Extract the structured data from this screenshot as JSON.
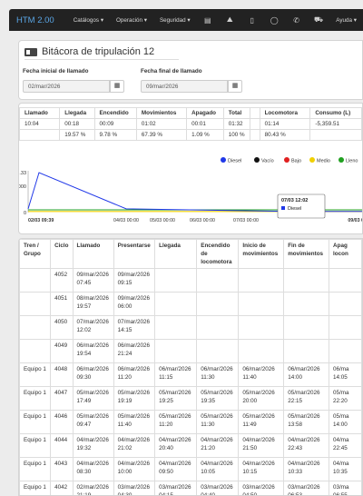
{
  "nav": {
    "brand": "HTM 2.00",
    "menus": [
      "Catálogos ▾",
      "Operación ▾",
      "Seguridad ▾"
    ],
    "help": "Ayuda ▾"
  },
  "bitacora": {
    "title": "Bitácora de tripulación 12",
    "start_label": "Fecha inicial de llamado",
    "start_value": "02/mar/2026",
    "end_label": "Fecha final de llamado",
    "end_value": "09/mar/2026"
  },
  "summary": {
    "headers": [
      "Llamado",
      "Llegada",
      "Encendido",
      "Movimientos",
      "Apagado",
      "Total",
      "",
      "Locomotora",
      "Consumo (L)"
    ],
    "row1": [
      "10:04",
      "00:18",
      "00:09",
      "01:02",
      "00:01",
      "01:32",
      "",
      "01:14",
      "-5,359.51"
    ],
    "row2": [
      "",
      "19.57 %",
      "9.78 %",
      "67.39 %",
      "1.09 %",
      "100 %",
      "",
      "80.43 %",
      ""
    ]
  },
  "chart_data": {
    "type": "line",
    "legend": [
      "Diesel",
      "Vacío",
      "Bajo",
      "Medio",
      "Lleno"
    ],
    "legend_colors": [
      "#2038e8",
      "#111111",
      "#e02020",
      "#f0d000",
      "#20a020"
    ],
    "y_ticks": [
      "21.33",
      "0000",
      "0"
    ],
    "x_ticks": [
      "02/03 09:39",
      "04/03 00:00",
      "05/03 00:00",
      "06/03 00:00",
      "07/03 00:00",
      "09/03 0"
    ],
    "series": [
      {
        "name": "Diesel",
        "color": "#2038e8",
        "x": [
          "02/03 09:39",
          "02/03 13:00",
          "03/03 06:00",
          "07/03 12:02",
          "09/03 00:00"
        ],
        "values": [
          2,
          21.33,
          2,
          0.6,
          0.6
        ]
      }
    ],
    "tooltip": {
      "title": "07/03 12:02",
      "label": "Diesel"
    }
  },
  "table": {
    "headers": [
      "Tren / Grupo",
      "Ciclo",
      "Llamado",
      "Presentarse",
      "Llegada",
      "Encendido de locomotora",
      "Inicio de movimientos",
      "Fin de movimientos",
      "Apag locon"
    ],
    "rows": [
      [
        "",
        "4052",
        "09/mar/2026 07:45",
        "09/mar/2026 09:15",
        "",
        "",
        "",
        "",
        ""
      ],
      [
        "",
        "4051",
        "08/mar/2026 19:57",
        "09/mar/2026 06:00",
        "",
        "",
        "",
        "",
        ""
      ],
      [
        "",
        "4050",
        "07/mar/2026 12:02",
        "07/mar/2026 14:15",
        "",
        "",
        "",
        "",
        ""
      ],
      [
        "",
        "4049",
        "06/mar/2026 19:54",
        "06/mar/2026 21:24",
        "",
        "",
        "",
        "",
        ""
      ],
      [
        "Equipo 1",
        "4048",
        "06/mar/2026 09:30",
        "06/mar/2026 11:20",
        "06/mar/2026 11:15",
        "06/mar/2026 11:30",
        "06/mar/2026 11:40",
        "06/mar/2026 14:00",
        "06/ma 14:05"
      ],
      [
        "Equipo 1",
        "4047",
        "05/mar/2026 17:49",
        "05/mar/2026 19:19",
        "05/mar/2026 19:25",
        "05/mar/2026 19:35",
        "05/mar/2026 20:00",
        "05/mar/2026 22:15",
        "05/ma 22:20"
      ],
      [
        "Equipo 1",
        "4046",
        "05/mar/2026 09:47",
        "05/mar/2026 11:40",
        "05/mar/2026 11:20",
        "05/mar/2026 11:30",
        "05/mar/2026 11:49",
        "05/mar/2026 13:58",
        "05/ma 14:00"
      ],
      [
        "Equipo 1",
        "4044",
        "04/mar/2026 19:32",
        "04/mar/2026 21:02",
        "04/mar/2026 20:40",
        "04/mar/2026 21:20",
        "04/mar/2026 21:50",
        "04/mar/2026 22:43",
        "04/ma 22:45"
      ],
      [
        "Equipo 1",
        "4043",
        "04/mar/2026 08:30",
        "04/mar/2026 10:00",
        "04/mar/2026 09:50",
        "04/mar/2026 10:05",
        "04/mar/2026 10:15",
        "04/mar/2026 10:33",
        "04/ma 10:35"
      ],
      [
        "Equipo 1",
        "4042",
        "02/mar/2026 21:19",
        "03/mar/2026 04:30",
        "03/mar/2026 04:15",
        "03/mar/2026 04:40",
        "03/mar/2026 04:50",
        "03/mar/2026 06:53",
        "03/ma 06:55"
      ]
    ]
  }
}
